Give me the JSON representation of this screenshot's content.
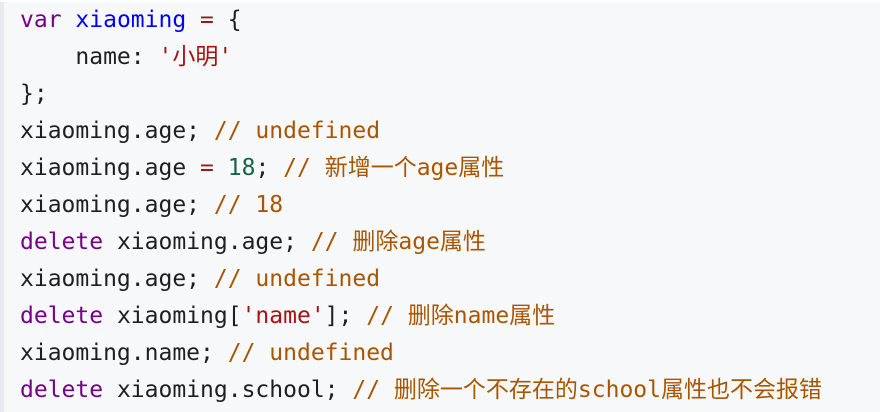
{
  "code": {
    "line1": {
      "kw": "var",
      "name": "xiaoming",
      "op": "=",
      "brace": "{"
    },
    "line2": {
      "prop": "name:",
      "str": "'小明'"
    },
    "line3": {
      "text": "};"
    },
    "line4": {
      "code": "xiaoming.age;",
      "comment": "// undefined"
    },
    "line5": {
      "code": "xiaoming.age",
      "op": "=",
      "num": "18",
      "semi": ";",
      "comment": "// 新增一个age属性"
    },
    "line6": {
      "code": "xiaoming.age;",
      "comment": "// 18"
    },
    "line7": {
      "kw": "delete",
      "code": "xiaoming.age;",
      "comment": "// 删除age属性"
    },
    "line8": {
      "code": "xiaoming.age;",
      "comment": "// undefined"
    },
    "line9": {
      "kw": "delete",
      "code1": "xiaoming[",
      "str": "'name'",
      "code2": "];",
      "comment": "// 删除name属性"
    },
    "line10": {
      "code": "xiaoming.name;",
      "comment": "// undefined"
    },
    "line11": {
      "kw": "delete",
      "code": "xiaoming.school;",
      "comment": "// 删除一个不存在的school属性也不会报错"
    }
  }
}
